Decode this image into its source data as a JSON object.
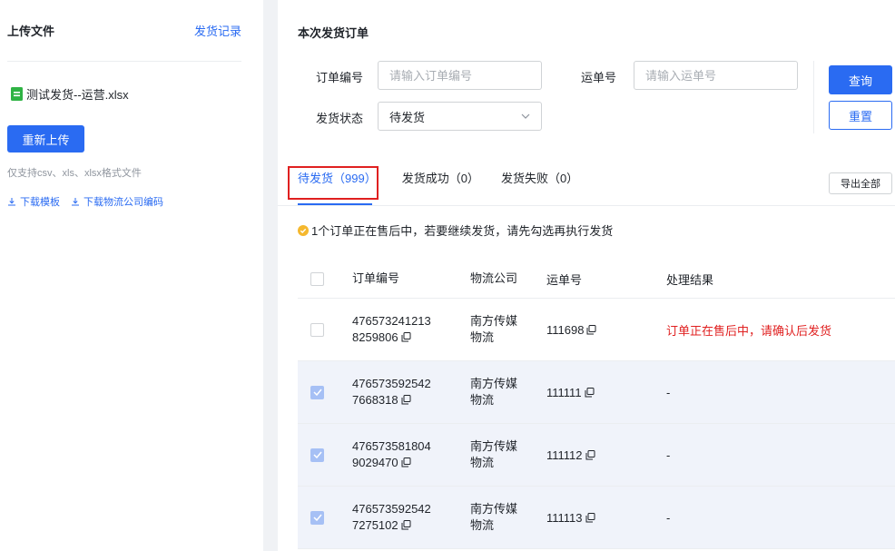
{
  "left": {
    "title": "上传文件",
    "history_link": "发货记录",
    "file_name": "测试发货--运营.xlsx",
    "reupload_label": "重新上传",
    "hint": "仅支持csv、xls、xlsx格式文件",
    "download_template": "下载模板",
    "download_codes": "下载物流公司编码"
  },
  "right": {
    "title": "本次发货订单",
    "filters": {
      "order_label": "订单编号",
      "order_placeholder": "请输入订单编号",
      "waybill_label": "运单号",
      "waybill_placeholder": "请输入运单号",
      "status_label": "发货状态",
      "status_value": "待发货"
    },
    "query_label": "查询",
    "reset_label": "重置",
    "tabs": [
      {
        "label": "待发货（999）"
      },
      {
        "label": "发货成功（0）"
      },
      {
        "label": "发货失败（0）"
      }
    ],
    "export_label": "导出全部",
    "notice": "1个订单正在售后中，若要继续发货，请先勾选再执行发货",
    "table": {
      "headers": [
        "订单编号",
        "物流公司",
        "运单号",
        "处理结果"
      ],
      "rows": [
        {
          "order_line1": "476573241213",
          "order_line2": "8259806",
          "company_line1": "南方传媒",
          "company_line2": "物流",
          "waybill": "111698",
          "result": "订单正在售后中，请确认后发货",
          "checked": false
        },
        {
          "order_line1": "476573592542",
          "order_line2": "7668318",
          "company_line1": "南方传媒",
          "company_line2": "物流",
          "waybill": "111111",
          "result": "-",
          "checked": true
        },
        {
          "order_line1": "476573581804",
          "order_line2": "9029470",
          "company_line1": "南方传媒",
          "company_line2": "物流",
          "waybill": "111112",
          "result": "-",
          "checked": true
        },
        {
          "order_line1": "476573592542",
          "order_line2": "7275102",
          "company_line1": "南方传媒",
          "company_line2": "物流",
          "waybill": "111113",
          "result": "-",
          "checked": true
        }
      ]
    }
  },
  "colors": {
    "primary": "#2a6bf2",
    "warning": "#e02020",
    "notice_icon": "#f5b82e",
    "file_icon": "#2fb344"
  },
  "icons": {
    "file": "excel-file-icon",
    "download": "download-icon",
    "chevron": "chevron-down-icon",
    "notice": "check-circle-icon",
    "copy": "copy-icon",
    "checkbox": "checkbox-icon"
  }
}
